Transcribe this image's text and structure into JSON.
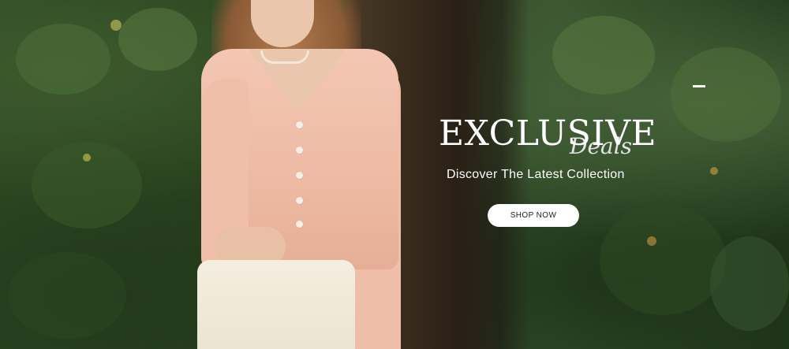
{
  "hero": {
    "headline": "EXCLUSIVE",
    "headline_script": "Deals",
    "subtitle": "Discover The Latest Collection",
    "cta_label": "SHOP NOW"
  },
  "colors": {
    "cta_background": "#ffffff",
    "text": "#ffffff",
    "sweater": "#f3c7b3",
    "foliage": "#2f4a23"
  }
}
